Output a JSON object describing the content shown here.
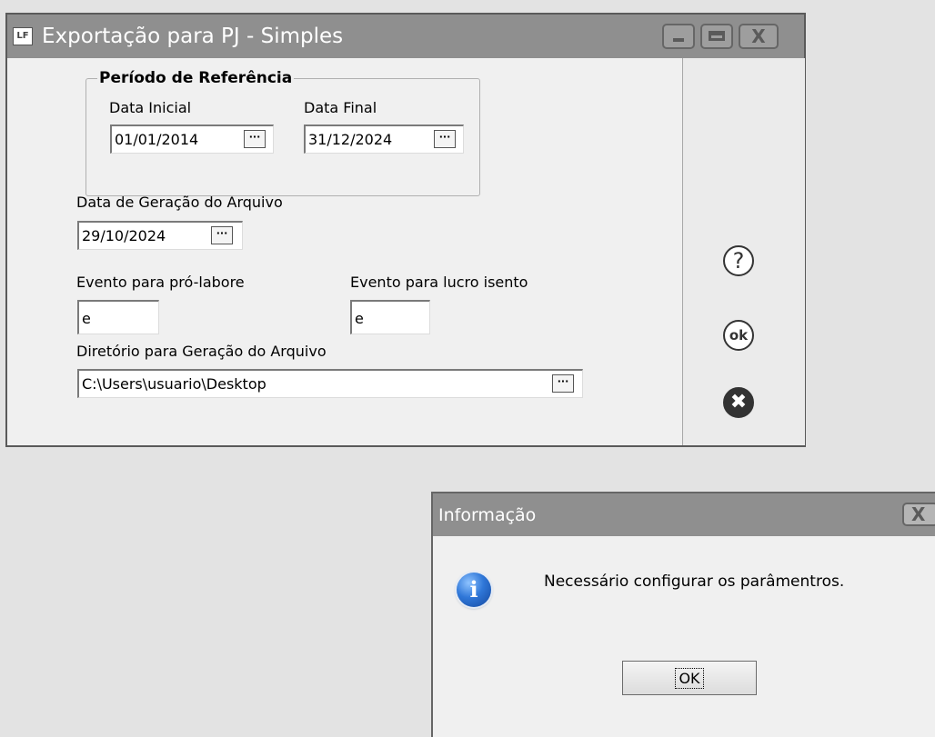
{
  "window": {
    "app_icon": "LF",
    "title": "Exportação para PJ - Simples",
    "controls": {
      "minimize": "_",
      "maximize": "□",
      "close": "X"
    }
  },
  "periodo": {
    "legend": "Período de Referência",
    "data_inicial_label": "Data Inicial",
    "data_inicial_value": "01/01/2014",
    "data_final_label": "Data Final",
    "data_final_value": "31/12/2024"
  },
  "geracao": {
    "label": "Data de Geração do Arquivo",
    "value": "29/10/2024"
  },
  "eventos": {
    "pro_labore_label": "Evento para pró-labore",
    "pro_labore_value": "e",
    "lucro_isento_label": "Evento para lucro isento",
    "lucro_isento_value": "e"
  },
  "diretorio": {
    "label": "Diretório para Geração do Arquivo",
    "value": "C:\\Users\\usuario\\Desktop"
  },
  "ellipsis": "···",
  "sidebar": {
    "help_glyph": "?",
    "ok_glyph": "ok",
    "cancel_glyph": "✖",
    "icons": [
      "help-icon",
      "ok-icon",
      "cancel-icon"
    ]
  },
  "dialog": {
    "title": "Informação",
    "close": "X",
    "icon": "information-icon",
    "icon_glyph": "i",
    "message": "Necessário configurar os parâmentros.",
    "ok_label": "OK"
  }
}
